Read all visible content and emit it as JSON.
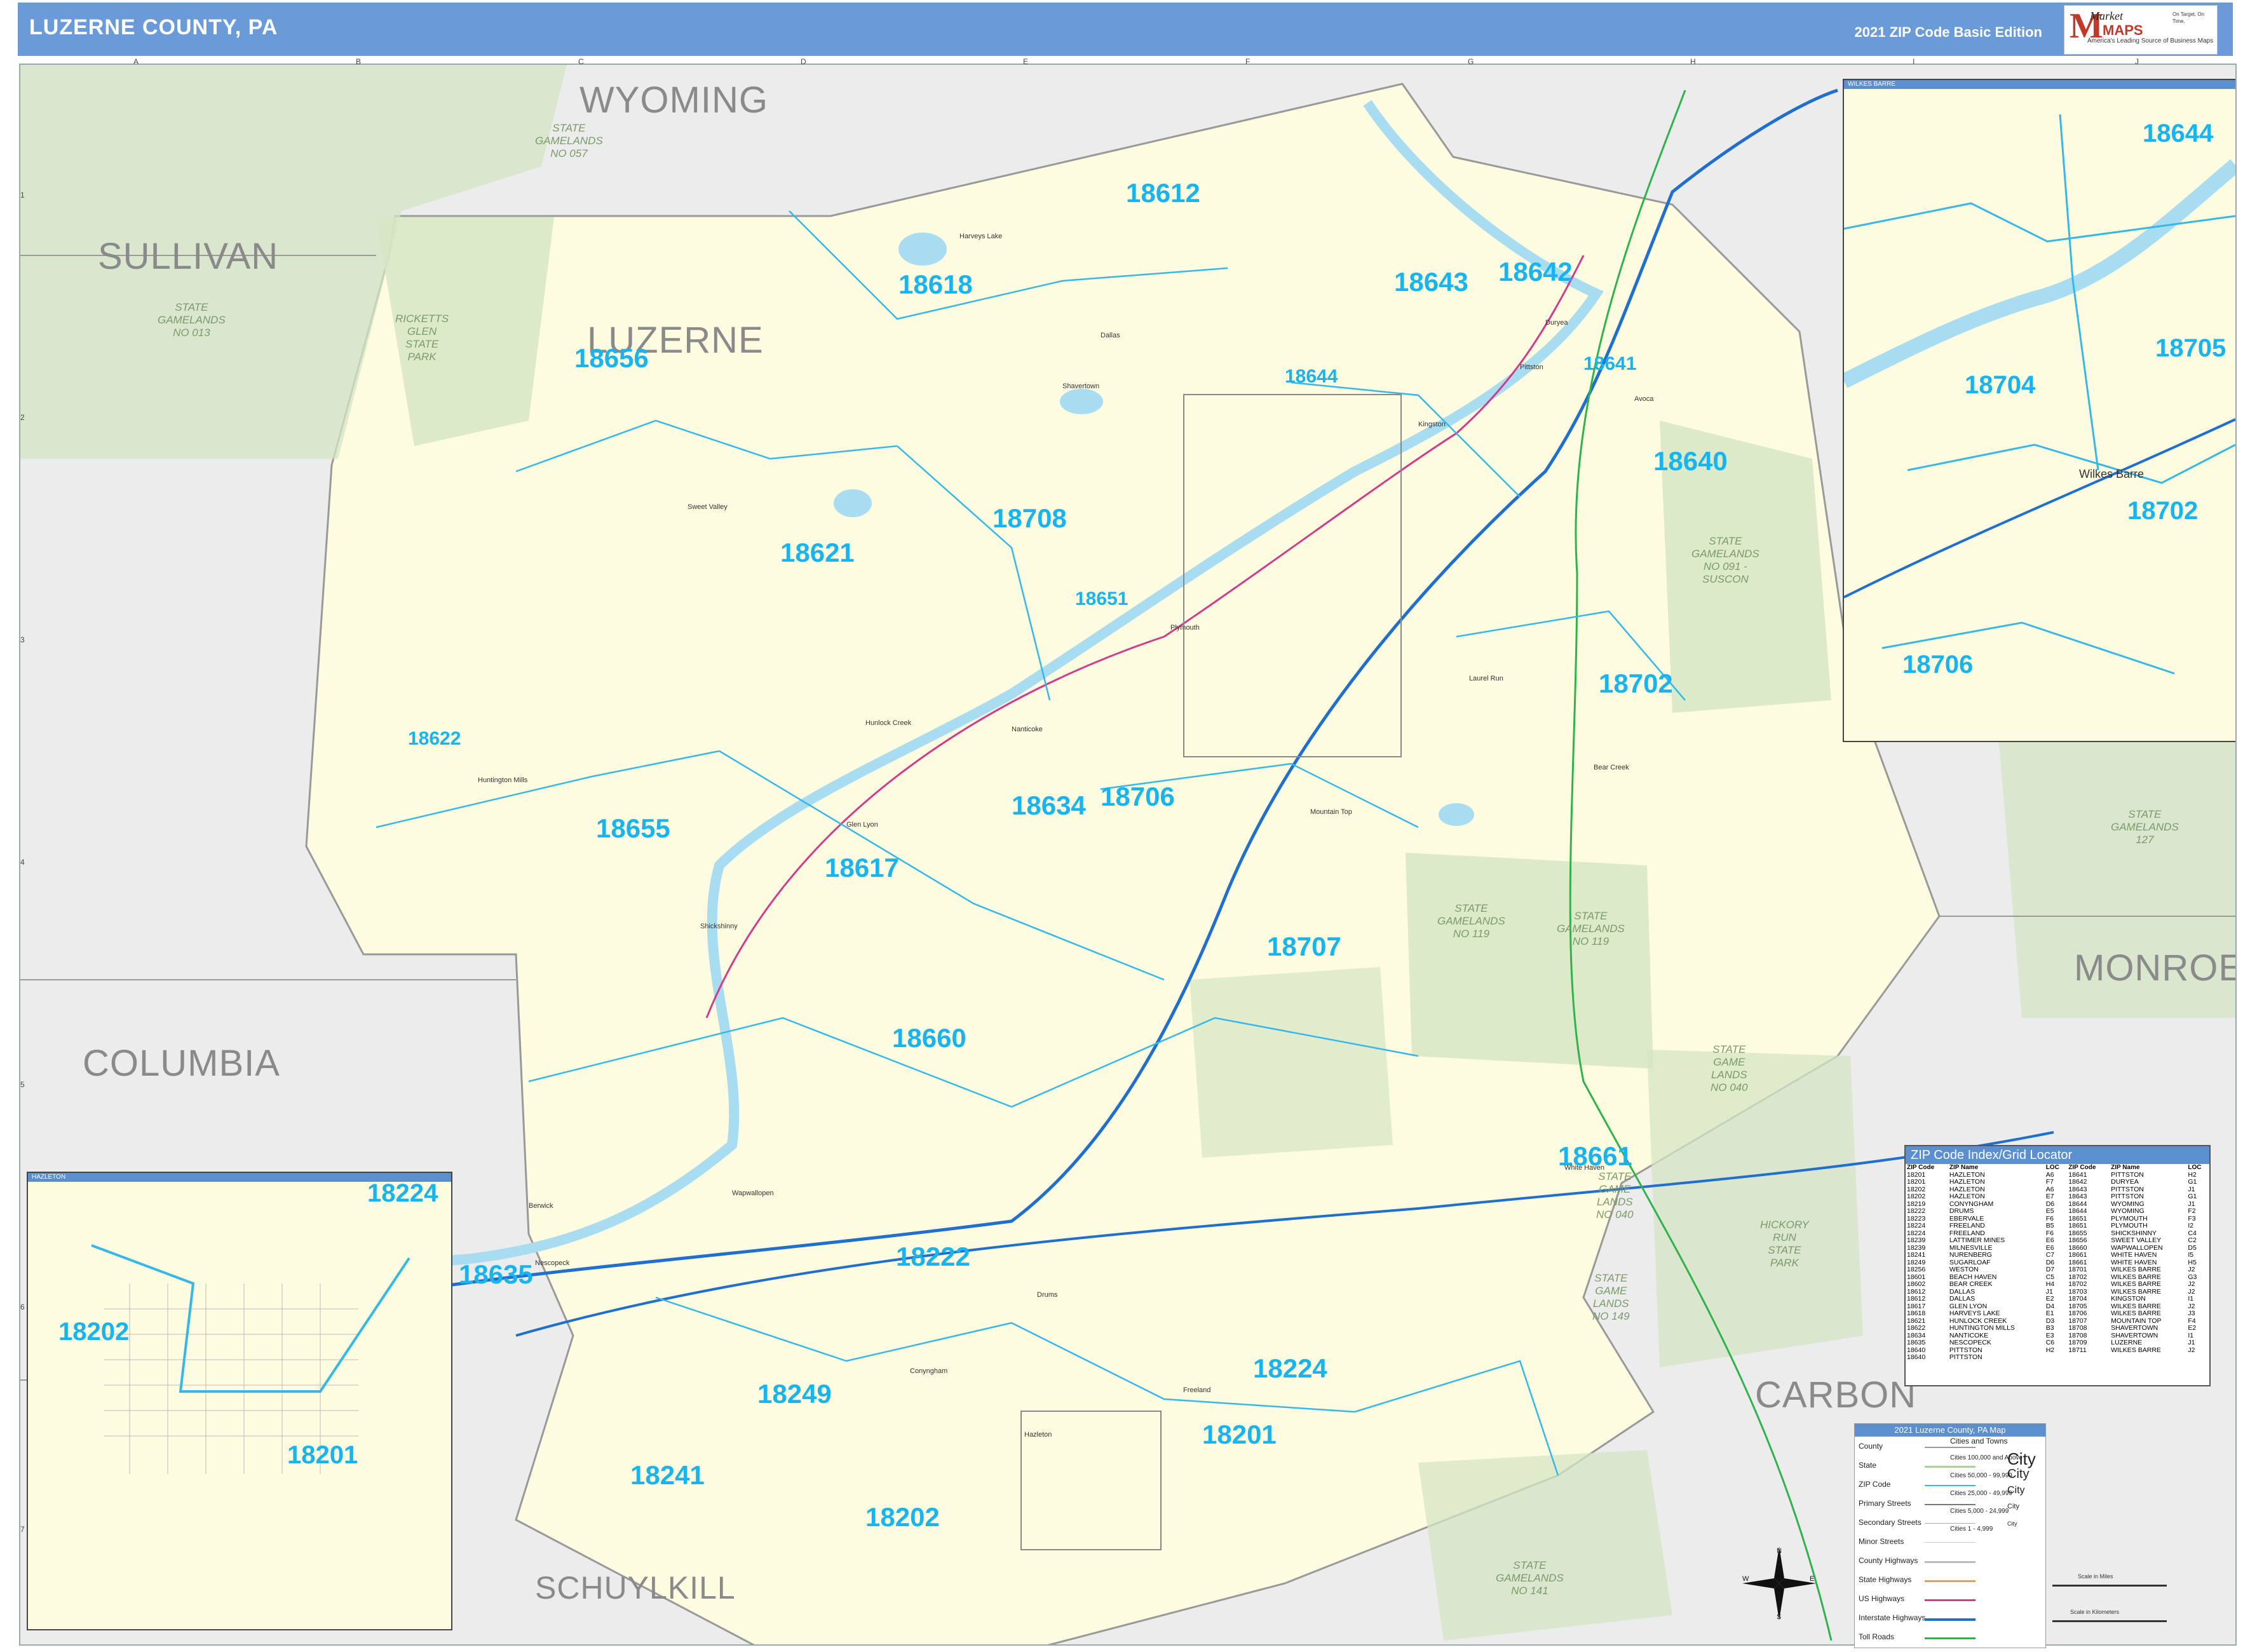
{
  "header": {
    "title": "LUZERNE COUNTY, PA",
    "edition": "2021 ZIP Code Basic Edition",
    "logo": {
      "brand_top": "Market",
      "brand_bottom": "MAPS",
      "tagline": "America's Leading Source of Business Maps",
      "slogan": "On Target. On Time."
    }
  },
  "grid": {
    "columns": [
      "A",
      "B",
      "C",
      "D",
      "E",
      "F",
      "G",
      "H",
      "I",
      "J"
    ],
    "rows": [
      "1",
      "2",
      "3",
      "4",
      "5",
      "6",
      "7"
    ]
  },
  "counties": {
    "wyoming": "WYOMING",
    "sullivan": "SULLIVAN",
    "luzerne": "LUZERNE",
    "columbia": "COLUMBIA",
    "monroe": "MONROE",
    "carbon": "CARBON",
    "schuylkill": "SCHUYLKILL"
  },
  "zips": {
    "z18612": "18612",
    "z18618": "18618",
    "z18656": "18656",
    "z18643": "18643",
    "z18642": "18642",
    "z18644": "18644",
    "z18641": "18641",
    "z18640": "18640",
    "z18708": "18708",
    "z18621": "18621",
    "z18651": "18651",
    "z18702": "18702",
    "z18622": "18622",
    "z18706": "18706",
    "z18634": "18634",
    "z18655": "18655",
    "z18617": "18617",
    "z18707": "18707",
    "z18660": "18660",
    "z18661": "18661",
    "z18635": "18635",
    "z18222": "18222",
    "z18224": "18224",
    "z18249": "18249",
    "z18201": "18201",
    "z18241": "18241",
    "z18202": "18202"
  },
  "gamelands": {
    "gl057": "STATE\nGAMELANDS\nNO 057",
    "gl013": "STATE\nGAMELANDS\nNO 013",
    "ricketts": "RICKETTS\nGLEN\nSTATE\nPARK",
    "gl091": "STATE\nGAMELANDS\nNO 091 -\nSUSCON",
    "gl127": "STATE\nGAMELANDS\n127",
    "gl119a": "STATE\nGAMELANDS\nNO 119",
    "gl119b": "STATE\nGAMELANDS\nNO 119",
    "gl040": "STATE\nGAME\nLANDS\nNO 040",
    "hickory": "HICKORY\nRUN\nSTATE\nPARK",
    "gl040b": "STATE\nGAME\nLANDS\nNO 040",
    "gl141": "STATE\nGAMELANDS\nNO 141",
    "gl149": "STATE\nGAME\nLANDS\nNO 149"
  },
  "insets": {
    "wilkes_barre": {
      "bar": "WILKES BARRE",
      "city": "Wilkes Barre",
      "zips": [
        "18644",
        "18705",
        "18704",
        "18702",
        "18706"
      ]
    },
    "hazleton": {
      "bar": "HAZLETON",
      "zips": [
        "18224",
        "18202",
        "18201"
      ]
    }
  },
  "index": {
    "title": "ZIP Code Index/Grid Locator",
    "headers": [
      "ZIP Code",
      "ZIP Name",
      "LOC",
      "ZIP Code",
      "ZIP Name",
      "LOC"
    ],
    "rows": [
      [
        "18201",
        "HAZLETON",
        "A6",
        "18641",
        "PITTSTON",
        "H2"
      ],
      [
        "18201",
        "HAZLETON",
        "F7",
        "18642",
        "DURYEA",
        "G1"
      ],
      [
        "18202",
        "HAZLETON",
        "A6",
        "18643",
        "PITTSTON",
        "J1"
      ],
      [
        "18202",
        "HAZLETON",
        "E7",
        "18643",
        "PITTSTON",
        "G1"
      ],
      [
        "18219",
        "CONYNGHAM",
        "D6",
        "18644",
        "WYOMING",
        "J1"
      ],
      [
        "18222",
        "DRUMS",
        "E5",
        "18644",
        "WYOMING",
        "F2"
      ],
      [
        "18223",
        "EBERVALE",
        "F6",
        "18651",
        "PLYMOUTH",
        "F3"
      ],
      [
        "18224",
        "FREELAND",
        "B5",
        "18651",
        "PLYMOUTH",
        "I2"
      ],
      [
        "18224",
        "FREELAND",
        "F6",
        "18655",
        "SHICKSHINNY",
        "C4"
      ],
      [
        "18239",
        "LATTIMER MINES",
        "E6",
        "18656",
        "SWEET VALLEY",
        "C2"
      ],
      [
        "18239",
        "MILNESVILLE",
        "E6",
        "18660",
        "WAPWALLOPEN",
        "D5"
      ],
      [
        "18241",
        "NURENBERG",
        "C7",
        "18661",
        "WHITE HAVEN",
        "I5"
      ],
      [
        "18249",
        "SUGARLOAF",
        "D6",
        "18661",
        "WHITE HAVEN",
        "H5"
      ],
      [
        "18256",
        "WESTON",
        "D7",
        "18701",
        "WILKES BARRE",
        "J2"
      ],
      [
        "18601",
        "BEACH HAVEN",
        "C5",
        "18702",
        "WILKES BARRE",
        "G3"
      ],
      [
        "18602",
        "BEAR CREEK",
        "H4",
        "18702",
        "WILKES BARRE",
        "J2"
      ],
      [
        "18612",
        "DALLAS",
        "J1",
        "18703",
        "WILKES BARRE",
        "J2"
      ],
      [
        "18612",
        "DALLAS",
        "E2",
        "18704",
        "KINGSTON",
        "I1"
      ],
      [
        "18617",
        "GLEN LYON",
        "D4",
        "18705",
        "WILKES BARRE",
        "J2"
      ],
      [
        "18618",
        "HARVEYS LAKE",
        "E1",
        "18706",
        "WILKES BARRE",
        "J3"
      ],
      [
        "18621",
        "HUNLOCK CREEK",
        "D3",
        "18707",
        "MOUNTAIN TOP",
        "F4"
      ],
      [
        "18622",
        "HUNTINGTON MILLS",
        "B3",
        "18708",
        "SHAVERTOWN",
        "E2"
      ],
      [
        "18634",
        "NANTICOKE",
        "E3",
        "18708",
        "SHAVERTOWN",
        "I1"
      ],
      [
        "18635",
        "NESCOPECK",
        "C6",
        "18709",
        "LUZERNE",
        "J1"
      ],
      [
        "18640",
        "PITTSTON",
        "H2",
        "18711",
        "WILKES BARRE",
        "J2"
      ],
      [
        "18640",
        "PITTSTON",
        "",
        "",
        "",
        ""
      ]
    ]
  },
  "legend": {
    "title": "2021 Luzerne County, PA Map",
    "items": [
      "County",
      "State",
      "ZIP Code",
      "Primary Streets",
      "Secondary Streets",
      "Minor Streets",
      "County Highways",
      "State Highways",
      "US Highways",
      "Interstate Highways",
      "Toll Roads"
    ],
    "cities_header": "Cities and Towns",
    "cities": [
      {
        "label": "Cities 100,000 and Above",
        "sample": "City"
      },
      {
        "label": "Cities 50,000 - 99,999",
        "sample": "City"
      },
      {
        "label": "Cities 25,000 - 49,999",
        "sample": "City"
      },
      {
        "label": "Cities 5,000 - 24,999",
        "sample": "City"
      },
      {
        "label": "Cities 1 - 4,999",
        "sample": "City"
      }
    ],
    "scale_miles": "Scale in Miles",
    "scale_km": "Scale in Kilometers"
  },
  "colors": {
    "header": "#6a9bd8",
    "county_fill": "#fdfbe0",
    "outside_fill": "#ececec",
    "gameland_fill": "#d4e6c4",
    "zip_boundary": "#35b8e8",
    "zip_label": "#18b4f0",
    "water": "#a8dcf0",
    "interstate": "#1f6fd0",
    "us_highway": "#d03c8c",
    "toll_road": "#2db34a",
    "state_highway": "#e0a050"
  },
  "towns": {
    "harveys_lake": "Harveys Lake",
    "shavertown": "Shavertown",
    "dallas": "Dallas",
    "kingston": "Kingston",
    "pittston": "Pittston",
    "plymouth": "Plymouth",
    "nanticoke": "Nanticoke",
    "shickshinny": "Shickshinny",
    "mountain_top": "Mountain Top",
    "white_haven": "White Haven",
    "freeland": "Freeland",
    "hazleton": "Hazleton",
    "berwick": "Berwick",
    "sweet_valley": "Sweet Valley",
    "huntington_mills": "Huntington Mills",
    "wapwallopen": "Wapwallopen",
    "drums": "Drums",
    "conyngham": "Conyngham",
    "bear_creek": "Bear Creek",
    "laurel_run": "Laurel Run",
    "glen_lyon": "Glen Lyon",
    "hunlock_creek": "Hunlock Creek",
    "nescopeck": "Nescopeck",
    "duryea": "Duryea",
    "avoca": "Avoca"
  }
}
